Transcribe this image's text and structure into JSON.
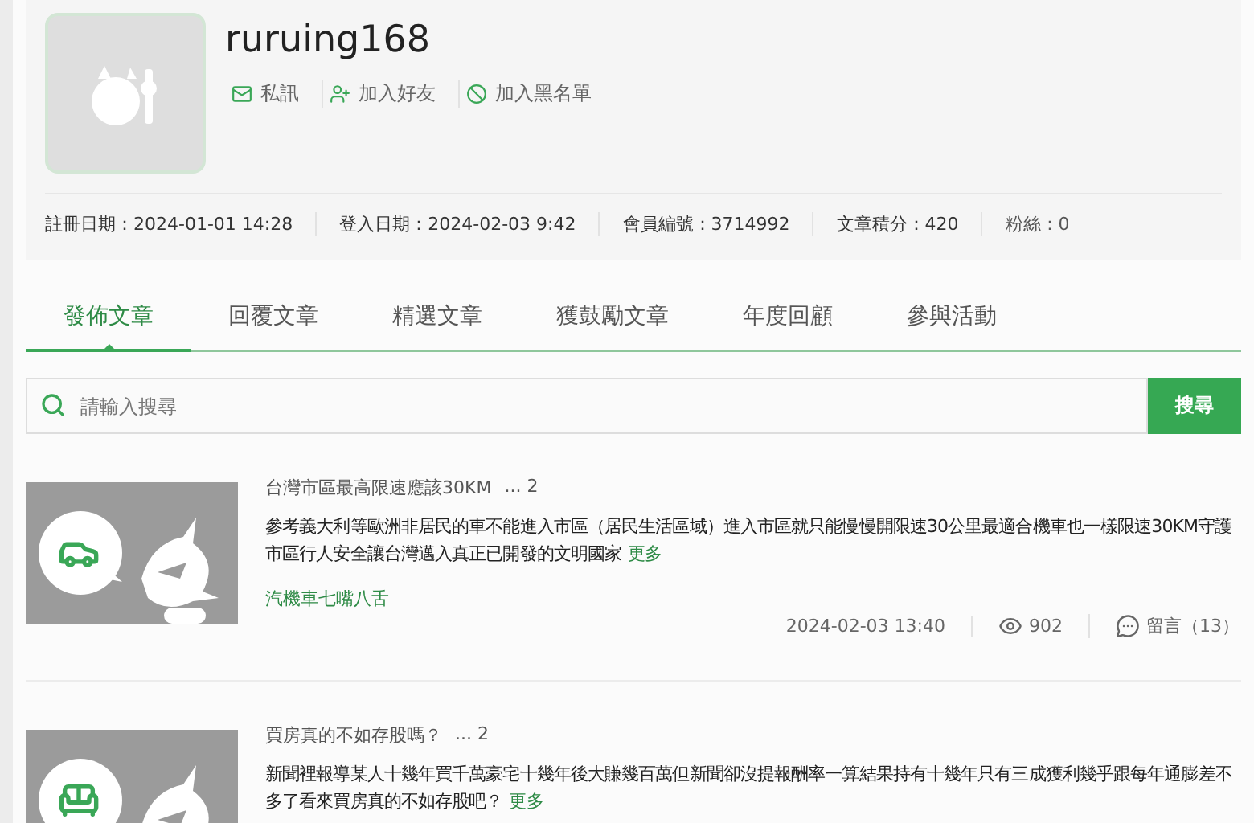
{
  "profile": {
    "username": "ruruing168",
    "actions": [
      {
        "kind": "message",
        "label": "私訊"
      },
      {
        "kind": "friend",
        "label": "加入好友"
      },
      {
        "kind": "block",
        "label": "加入黑名單"
      }
    ],
    "stats": [
      "註冊日期：2024-01-01 14:28",
      "登入日期：2024-02-03 9:42",
      "會員編號：3714992",
      "文章積分：420",
      "粉絲：0"
    ]
  },
  "tabs": [
    {
      "label": "發佈文章",
      "selected": true
    },
    {
      "label": "回覆文章",
      "selected": false
    },
    {
      "label": "精選文章",
      "selected": false
    },
    {
      "label": "獲鼓勵文章",
      "selected": false
    },
    {
      "label": "年度回顧",
      "selected": false
    },
    {
      "label": "參與活動",
      "selected": false
    }
  ],
  "search": {
    "placeholder": "請輸入搜尋",
    "button": "搜尋"
  },
  "posts": [
    {
      "kind": "car",
      "title": "台灣市區最高限速應該30KM",
      "count": "...  2",
      "body": "參考義大利等歐洲非居民的車不能進入市區（居民生活區域）進入市區就只能慢慢開限速30公里最適合機車也一樣限速30KM守護市區行人安全讓台灣邁入真正已開發的文明國家",
      "more": "更多",
      "tag": "汽機車七嘴八舌",
      "date": "2024-02-03 13:40",
      "views": "902",
      "comments": "留言（13）"
    },
    {
      "kind": "furniture",
      "title": "買房真的不如存股嗎？",
      "count": "...  2",
      "body": "新聞裡報導某人十幾年買千萬豪宅十幾年後大賺幾百萬但新聞卻沒提報酬率一算結果持有十幾年只有三成獲利幾乎跟每年通膨差不多了看來買房真的不如存股吧？",
      "more": "更多"
    }
  ]
}
